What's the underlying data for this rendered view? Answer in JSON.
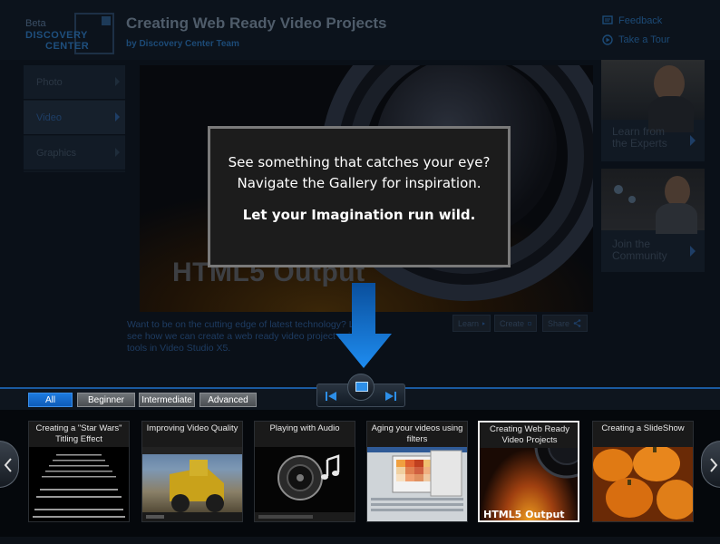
{
  "header": {
    "logo_beta": "Beta",
    "logo_line1": "DISCOVERY",
    "logo_line2": "CENTER",
    "title": "Creating Web Ready Video Projects",
    "subtitle": "by Discovery Center Team",
    "feedback": "Feedback",
    "tour": "Take a Tour"
  },
  "left_menu": {
    "items": [
      {
        "label": "Photo",
        "active": false
      },
      {
        "label": "Video",
        "active": true
      },
      {
        "label": "Graphics",
        "active": false
      }
    ]
  },
  "hero": {
    "heading": "HTML5 Output",
    "description": "Want to be on the cutting edge of latest technology? Let us see how we can create a web ready video project using our tools in Video Studio X5.",
    "learn": "Learn",
    "create": "Create",
    "share": "Share"
  },
  "right_tiles": {
    "experts_line1": "Learn from",
    "experts_line2": "the Experts",
    "community_line1": "Join the",
    "community_line2": "Community"
  },
  "popup": {
    "line1": "See something that catches your eye?",
    "line2": "Navigate the Gallery for inspiration.",
    "line3": "Let your Imagination run wild."
  },
  "filters": {
    "all": "All",
    "beginner": "Beginner",
    "intermediate": "Intermediate",
    "advanced": "Advanced",
    "selected": "All"
  },
  "gallery": {
    "items": [
      {
        "title": "Creating a \"Star Wars\" Titling Effect"
      },
      {
        "title": "Improving Video Quality"
      },
      {
        "title": "Playing with Audio"
      },
      {
        "title": "Aging your videos using filters"
      },
      {
        "title": "Creating Web Ready Video Projects",
        "overlay": "HTML5 Output",
        "selected": true
      },
      {
        "title": "Creating a SlideShow"
      }
    ]
  },
  "colors": {
    "accent_blue": "#1c7ae0",
    "popup_bg": "#1c1c1c",
    "popup_border": "#7a7a7a",
    "page_bg": "#0a1018"
  }
}
